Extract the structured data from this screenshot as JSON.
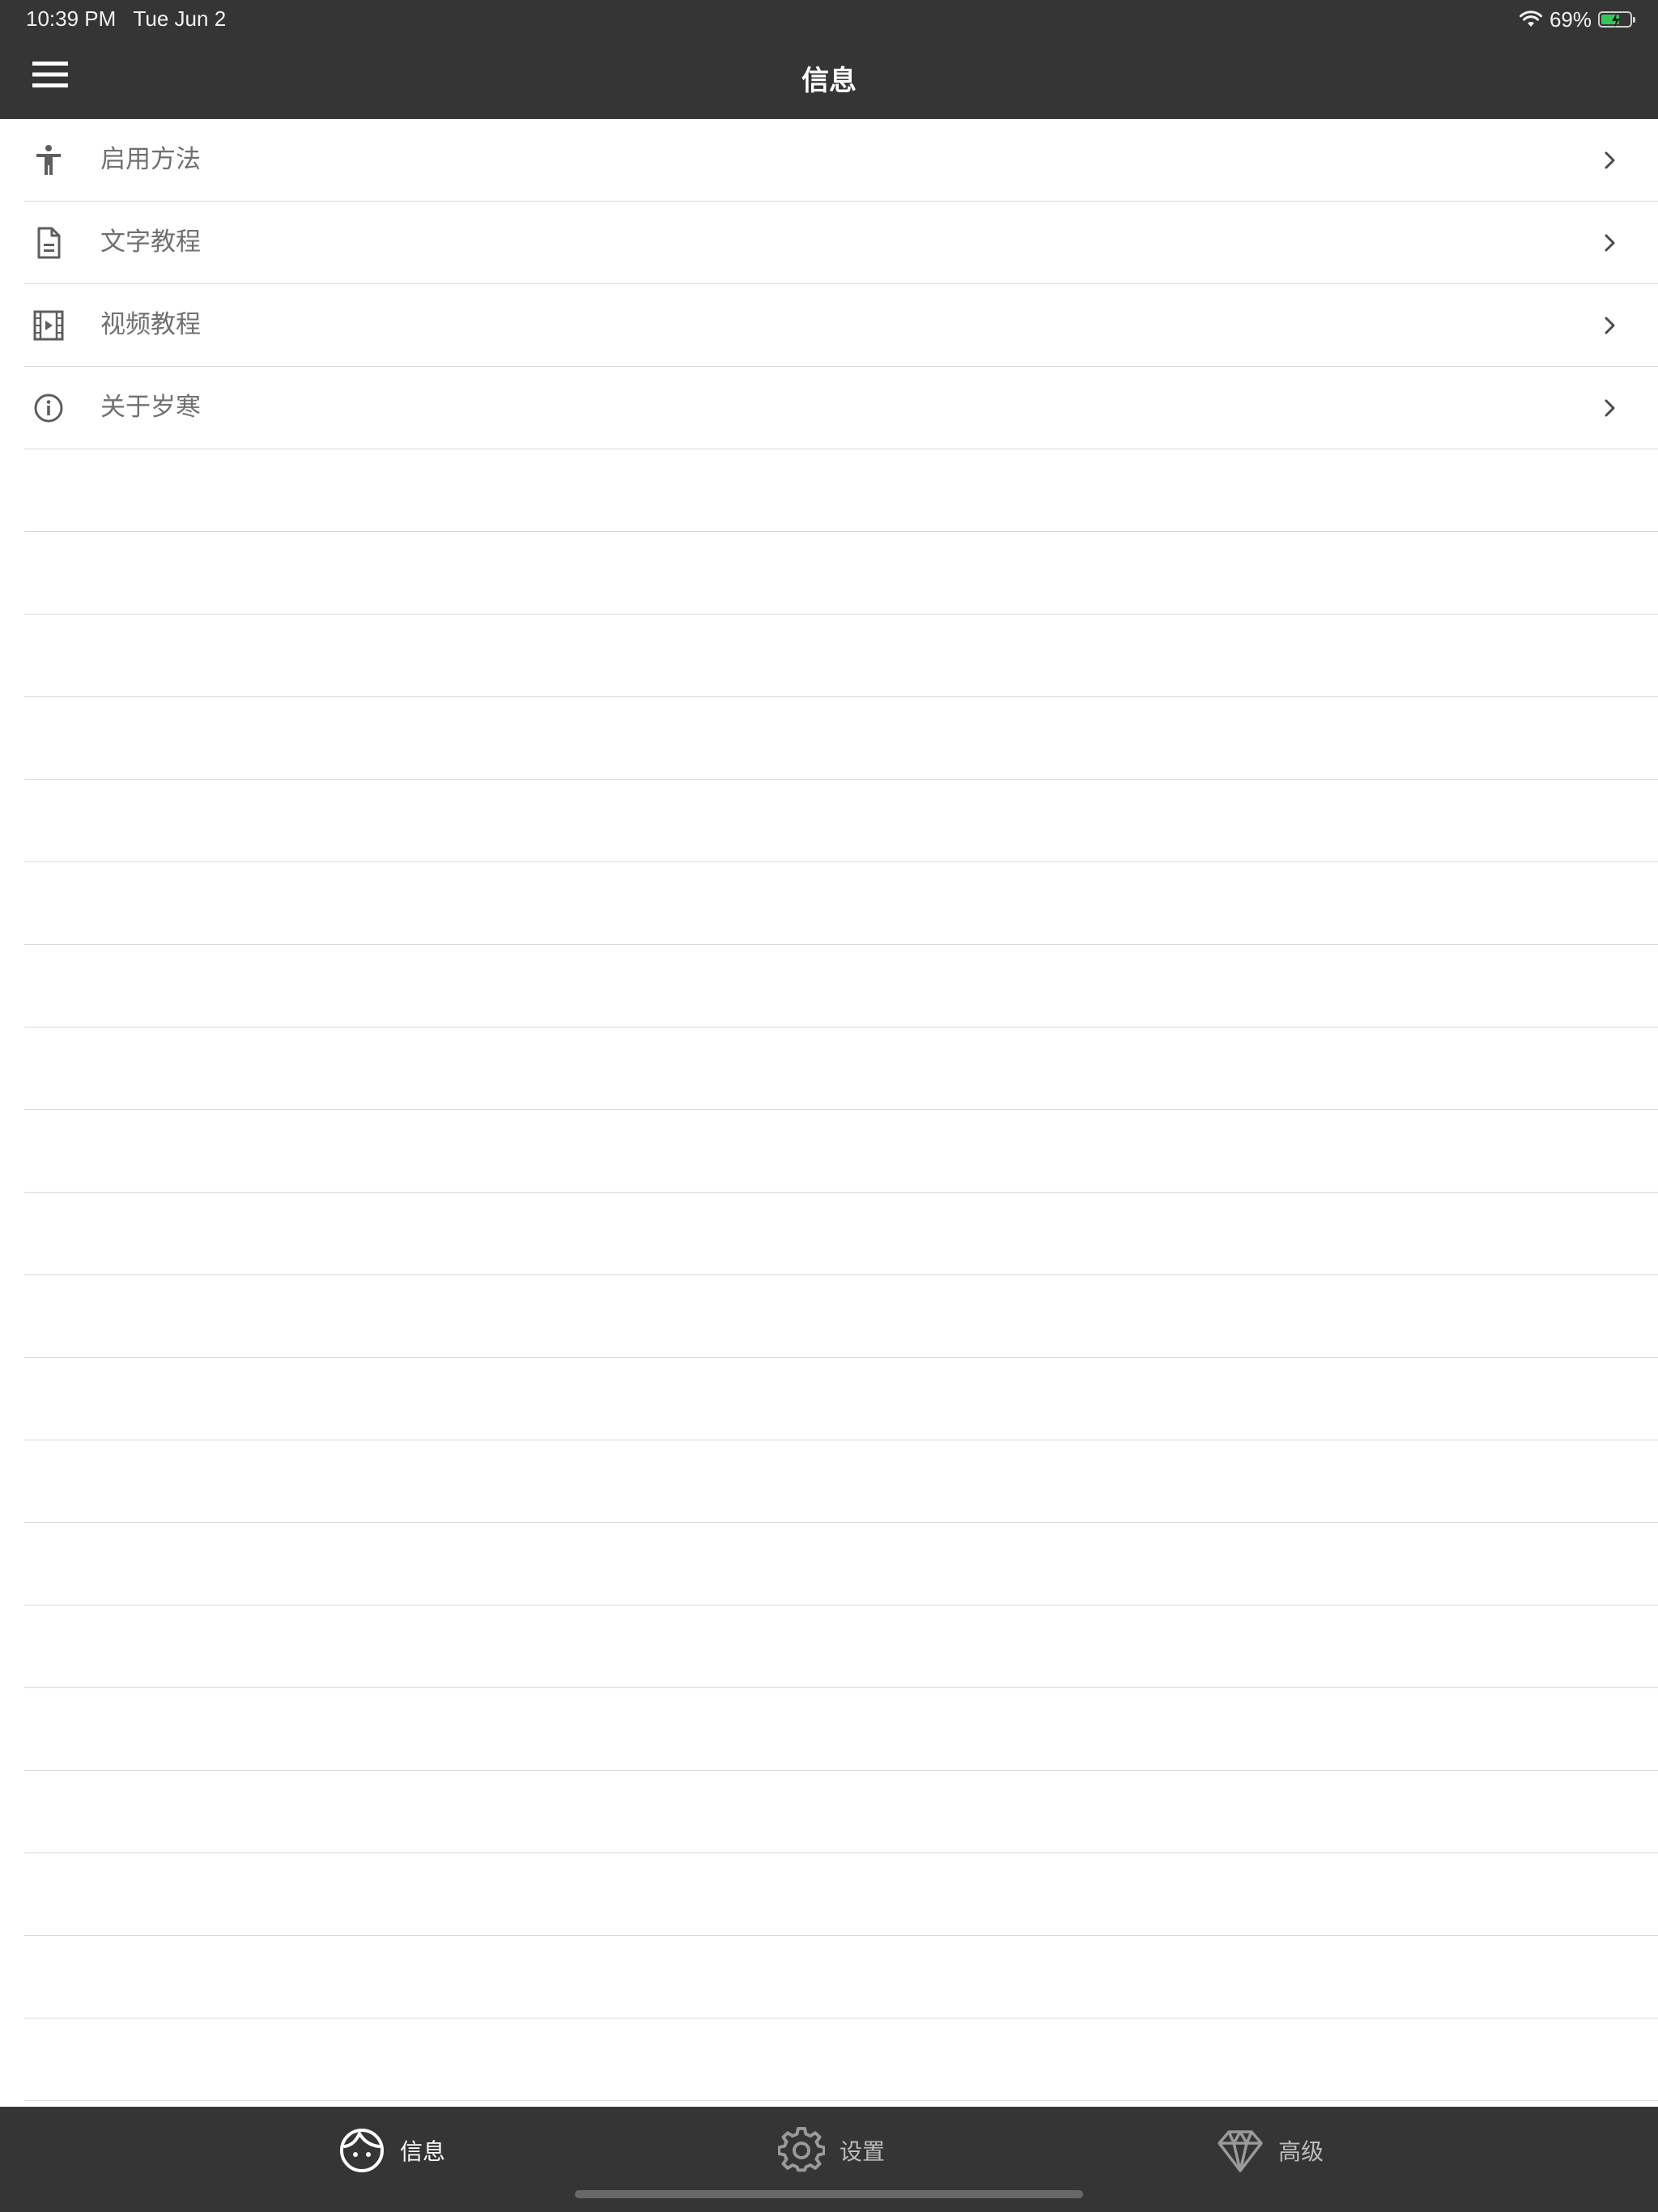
{
  "status_bar": {
    "time": "10:39 PM",
    "date": "Tue Jun 2",
    "battery_percent": "69%",
    "battery_level": 0.69,
    "wifi_icon": "wifi-icon",
    "battery_icon": "battery-charging-icon"
  },
  "header": {
    "title": "信息",
    "menu_icon": "hamburger-menu-icon",
    "background": "#353535"
  },
  "list": {
    "items": [
      {
        "label": "启用方法",
        "icon": "accessibility-icon"
      },
      {
        "label": "文字教程",
        "icon": "document-icon"
      },
      {
        "label": "视频教程",
        "icon": "video-film-icon"
      },
      {
        "label": "关于岁寒",
        "icon": "info-circle-icon"
      }
    ],
    "chevron_icon": "chevron-right-icon"
  },
  "tabbar": {
    "tabs": [
      {
        "label": "信息",
        "icon": "face-icon",
        "active": true
      },
      {
        "label": "设置",
        "icon": "gear-icon",
        "active": false
      },
      {
        "label": "高级",
        "icon": "diamond-icon",
        "active": false
      }
    ],
    "background": "#353535"
  }
}
